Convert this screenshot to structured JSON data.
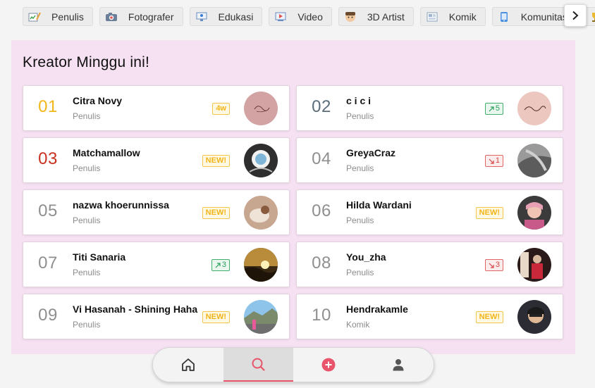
{
  "categories": [
    {
      "label": "Penulis",
      "icon": "writing-icon"
    },
    {
      "label": "Fotografer",
      "icon": "camera-icon"
    },
    {
      "label": "Edukasi",
      "icon": "education-icon"
    },
    {
      "label": "Video",
      "icon": "video-icon"
    },
    {
      "label": "3D Artist",
      "icon": "3d-artist-icon"
    },
    {
      "label": "Komik",
      "icon": "comic-icon"
    },
    {
      "label": "Komunitas",
      "icon": "community-icon"
    }
  ],
  "panel": {
    "title": "Kreator Minggu ini!",
    "background": "#f5e1f1"
  },
  "creators": [
    {
      "rank": "01",
      "name": "Citra Novy",
      "category": "Penulis",
      "badge": "4w",
      "badge_type": "gold",
      "rank_color": "#f2b51a"
    },
    {
      "rank": "02",
      "name": "c i c i",
      "category": "Penulis",
      "badge": "5",
      "badge_type": "up",
      "rank_color": "#5a6e7a"
    },
    {
      "rank": "03",
      "name": "Matchamallow",
      "category": "Penulis",
      "badge": "NEW!",
      "badge_type": "gold",
      "rank_color": "#c8321e"
    },
    {
      "rank": "04",
      "name": "GreyaCraz",
      "category": "Penulis",
      "badge": "1",
      "badge_type": "down",
      "rank_color": "#8f8f8f"
    },
    {
      "rank": "05",
      "name": "nazwa khoerunnissa",
      "category": "Penulis",
      "badge": "NEW!",
      "badge_type": "gold",
      "rank_color": "#8f8f8f"
    },
    {
      "rank": "06",
      "name": "Hilda Wardani",
      "category": "Penulis",
      "badge": "NEW!",
      "badge_type": "gold",
      "rank_color": "#8f8f8f"
    },
    {
      "rank": "07",
      "name": "Titi Sanaria",
      "category": "Penulis",
      "badge": "3",
      "badge_type": "up",
      "rank_color": "#8f8f8f"
    },
    {
      "rank": "08",
      "name": "You_zha",
      "category": "Penulis",
      "badge": "3",
      "badge_type": "down",
      "rank_color": "#8f8f8f"
    },
    {
      "rank": "09",
      "name": "Vi Hasanah - Shining Haha",
      "category": "Penulis",
      "badge": "NEW!",
      "badge_type": "gold",
      "rank_color": "#8f8f8f"
    },
    {
      "rank": "10",
      "name": "Hendrakamle",
      "category": "Komik",
      "badge": "NEW!",
      "badge_type": "gold",
      "rank_color": "#8f8f8f"
    }
  ],
  "bottom_nav": [
    {
      "name": "home-icon",
      "active": false
    },
    {
      "name": "search-icon",
      "active": true
    },
    {
      "name": "add-circle-icon",
      "active": false
    },
    {
      "name": "profile-icon",
      "active": false
    }
  ],
  "colors": {
    "accent": "#e8556a",
    "new_badge": "#f2b51a",
    "rank_up": "#27a25b",
    "rank_down": "#d64545"
  }
}
